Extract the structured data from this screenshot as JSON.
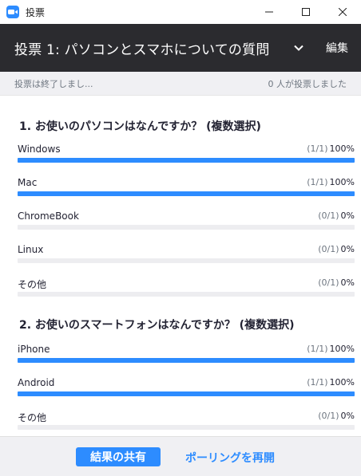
{
  "window": {
    "title": "投票",
    "icon": "zoom-app-icon"
  },
  "header": {
    "title": "投票 1: パソコンとスマホについての質問",
    "edit_label": "編集"
  },
  "status": {
    "left": "投票は終了しまし...",
    "right": "0 人が投票しました"
  },
  "questions": [
    {
      "text": "1. お使いのパソコンはなんですか？ (複数選択)",
      "options": [
        {
          "label": "Windows",
          "count": "(1/1)",
          "percent": "100%",
          "fraction": 1.0
        },
        {
          "label": "Mac",
          "count": "(1/1)",
          "percent": "100%",
          "fraction": 1.0
        },
        {
          "label": "ChromeBook",
          "count": "(0/1)",
          "percent": "0%",
          "fraction": 0.0
        },
        {
          "label": "Linux",
          "count": "(0/1)",
          "percent": "0%",
          "fraction": 0.0
        },
        {
          "label": "その他",
          "count": "(0/1)",
          "percent": "0%",
          "fraction": 0.0
        }
      ]
    },
    {
      "text": "2. お使いのスマートフォンはなんですか？ (複数選択)",
      "options": [
        {
          "label": "iPhone",
          "count": "(1/1)",
          "percent": "100%",
          "fraction": 1.0
        },
        {
          "label": "Android",
          "count": "(1/1)",
          "percent": "100%",
          "fraction": 1.0
        },
        {
          "label": "その他",
          "count": "(0/1)",
          "percent": "0%",
          "fraction": 0.0
        }
      ]
    }
  ],
  "footer": {
    "share_label": "結果の共有",
    "reopen_label": "ポーリングを再開"
  },
  "colors": {
    "accent": "#2D8CFF",
    "header_bg": "#2b2b2f",
    "track": "#ededf0"
  }
}
